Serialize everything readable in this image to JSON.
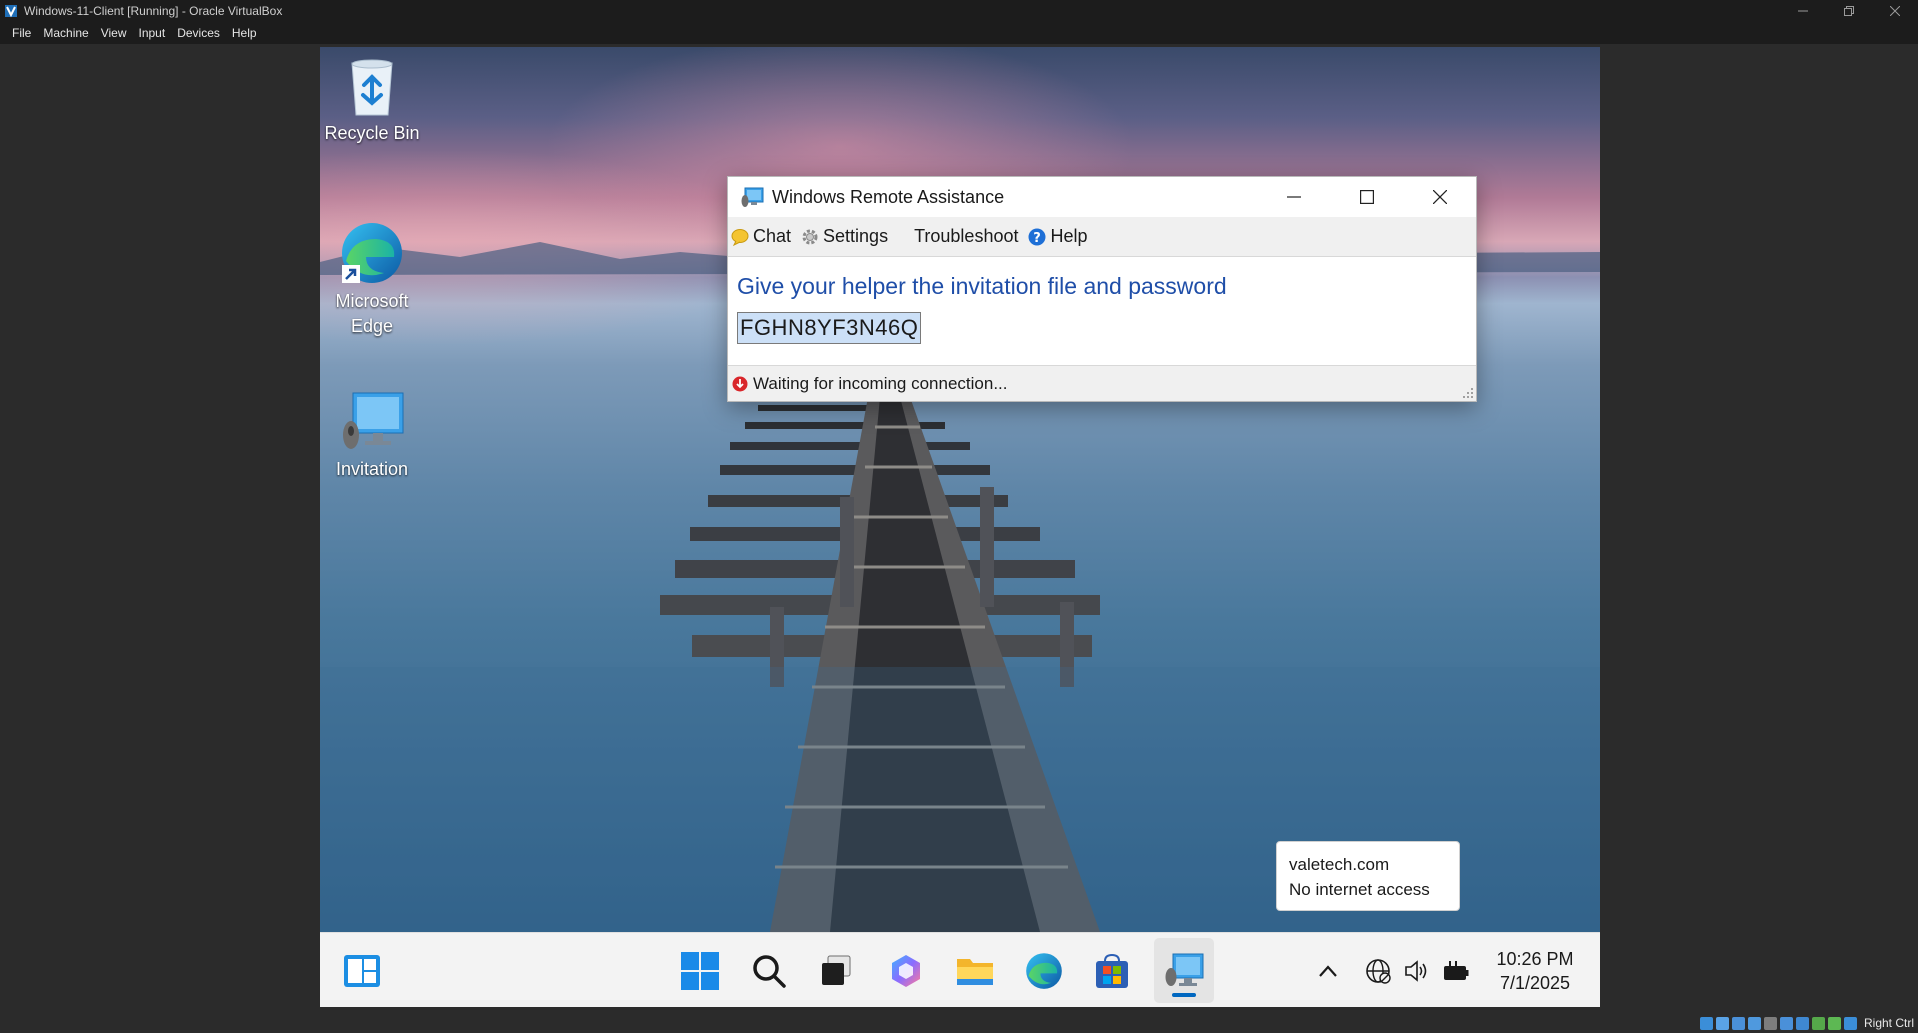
{
  "vbox": {
    "window_title": "Windows-11-Client [Running] - Oracle VirtualBox",
    "menu": [
      "File",
      "Machine",
      "View",
      "Input",
      "Devices",
      "Help"
    ],
    "host_key_label": "Right Ctrl"
  },
  "desktop": {
    "icons": [
      {
        "label": "Recycle Bin",
        "icon": "recycle-bin-icon"
      },
      {
        "label": "Microsoft\nEdge",
        "icon": "edge-icon"
      },
      {
        "label": "Invitation",
        "icon": "remote-assistance-icon"
      }
    ]
  },
  "remote_assistance": {
    "title": "Windows Remote Assistance",
    "toolbar": {
      "chat": "Chat",
      "settings": "Settings",
      "troubleshoot": "Troubleshoot",
      "help": "Help"
    },
    "heading": "Give your helper the invitation file and password",
    "password": "FGHN8YF3N46Q",
    "status": "Waiting for incoming connection..."
  },
  "network_tooltip": {
    "line1": "valetech.com",
    "line2": "No internet access"
  },
  "taskbar": {
    "apps": [
      "start-icon",
      "search-icon",
      "task-view-icon",
      "copilot-icon",
      "file-explorer-icon",
      "edge-icon",
      "store-icon",
      "remote-assistance-icon"
    ],
    "active_app": "remote-assistance-icon",
    "clock": {
      "time": "10:26 PM",
      "date": "7/1/2025"
    }
  },
  "colors": {
    "accent": "#0067c0",
    "heading_blue": "#1f4ea8",
    "selection": "#cce0f7"
  }
}
